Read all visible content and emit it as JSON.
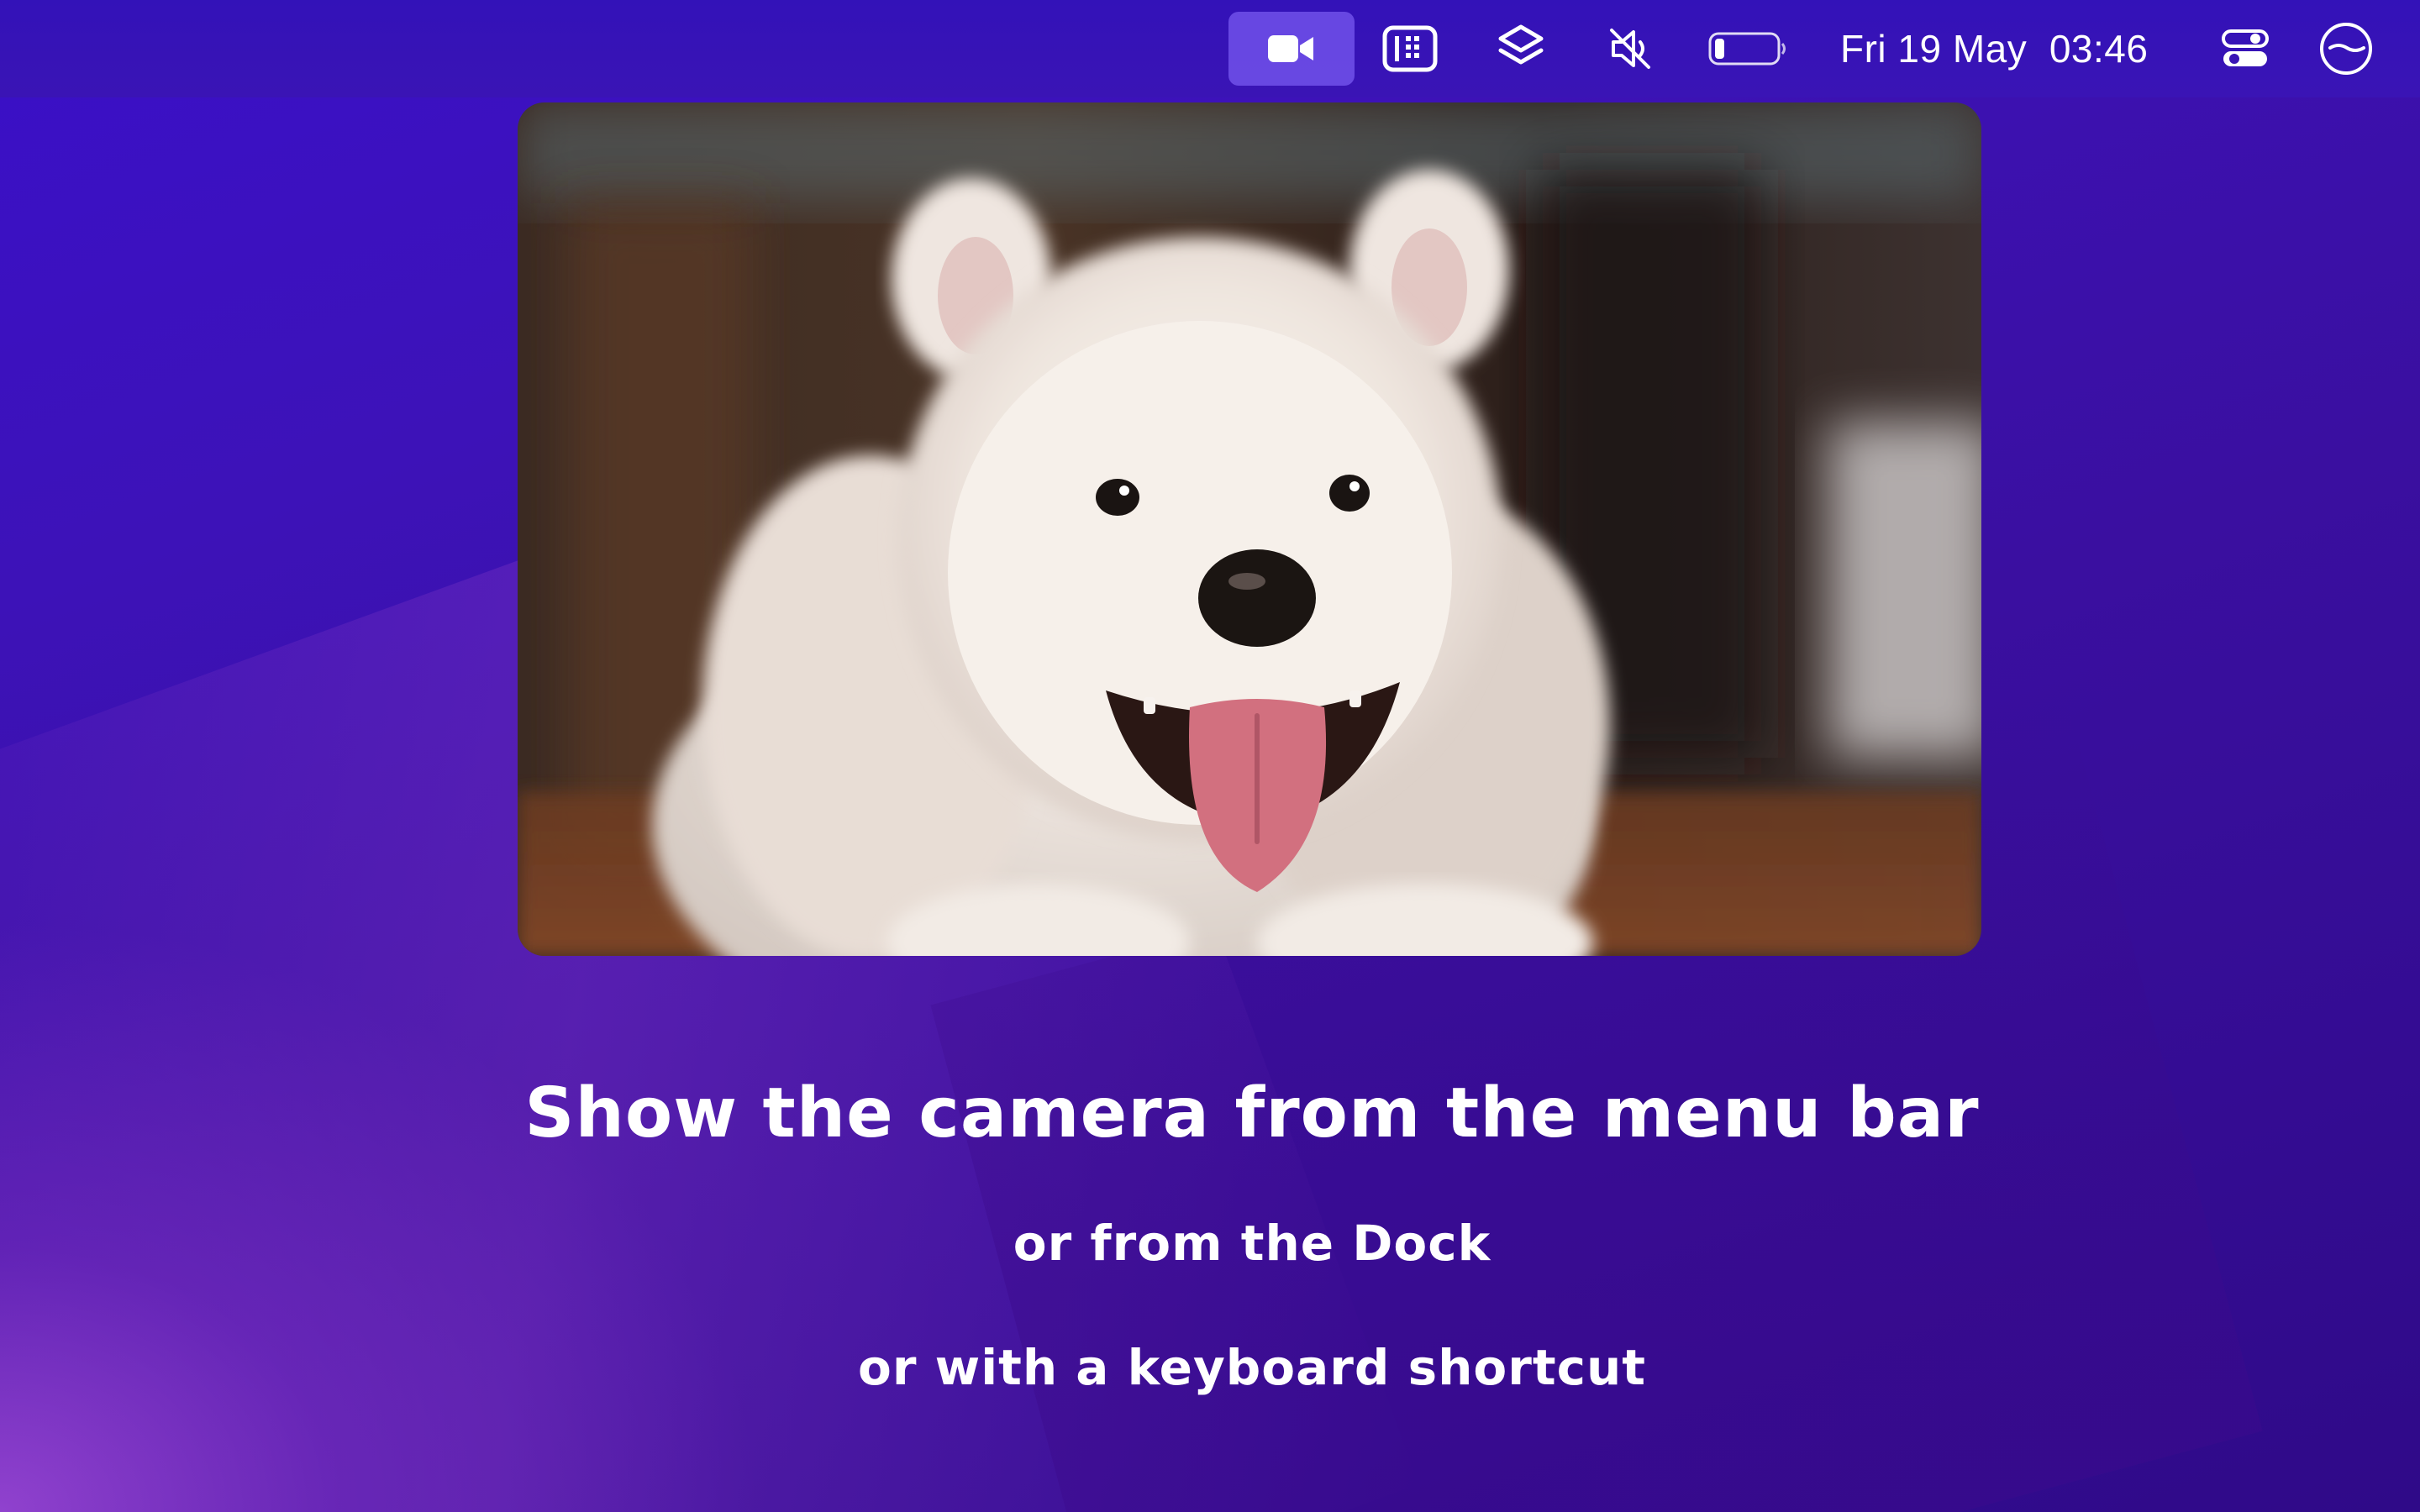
{
  "menubar": {
    "status_items": [
      {
        "icon": "video-camera-icon",
        "active": true
      },
      {
        "icon": "grid-window-icon",
        "active": false
      },
      {
        "icon": "layers-icon",
        "active": false
      },
      {
        "icon": "speaker-muted-icon",
        "active": false
      },
      {
        "icon": "battery-icon",
        "active": false,
        "battery_level": 0.15
      }
    ],
    "date": "Fri 19 May",
    "time": "03:46",
    "control_center_icon": "control-center-icon",
    "siri_icon": "siri-icon"
  },
  "camera_preview": {
    "subject": "camera-feed-puppy"
  },
  "captions": {
    "headline": "Show the camera from the menu bar",
    "line2": "or from the Dock",
    "line3": "or with a keyboard shortcut"
  },
  "colors": {
    "background_primary": "#3a10c8",
    "background_accent": "#9646d2",
    "active_highlight": "#785af0",
    "text": "#ffffff"
  }
}
